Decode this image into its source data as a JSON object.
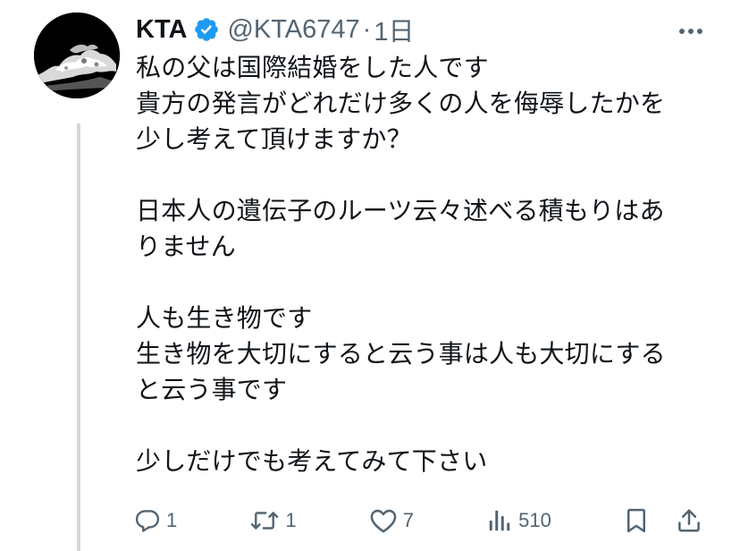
{
  "post": {
    "author": {
      "display_name": "KTA",
      "handle": "@KTA6747",
      "verified": true
    },
    "separator": "·",
    "time": "1日",
    "lines": [
      "私の父は国際結婚をした人です",
      "貴方の発言がどれだけ多くの人を侮辱したかを",
      "少し考えて頂けますか？",
      "",
      "日本人の遺伝子のルーツ云々述べる積もりはあ",
      "りません",
      "",
      "人も生き物です",
      "生き物を大切にすると云う事は人も大切にする",
      "と云う事です",
      "",
      "少しだけでも考えてみて下さい"
    ],
    "stats": {
      "replies": "1",
      "reposts": "1",
      "likes": "7",
      "views": "510"
    }
  },
  "colors": {
    "text": "#0f1419",
    "secondary": "#536471",
    "verified": "#1d9bf0",
    "thread_line": "#cfd9de"
  },
  "icons": [
    "more-icon",
    "verified-icon",
    "reply-icon",
    "repost-icon",
    "like-icon",
    "views-icon",
    "bookmark-icon",
    "share-icon"
  ]
}
